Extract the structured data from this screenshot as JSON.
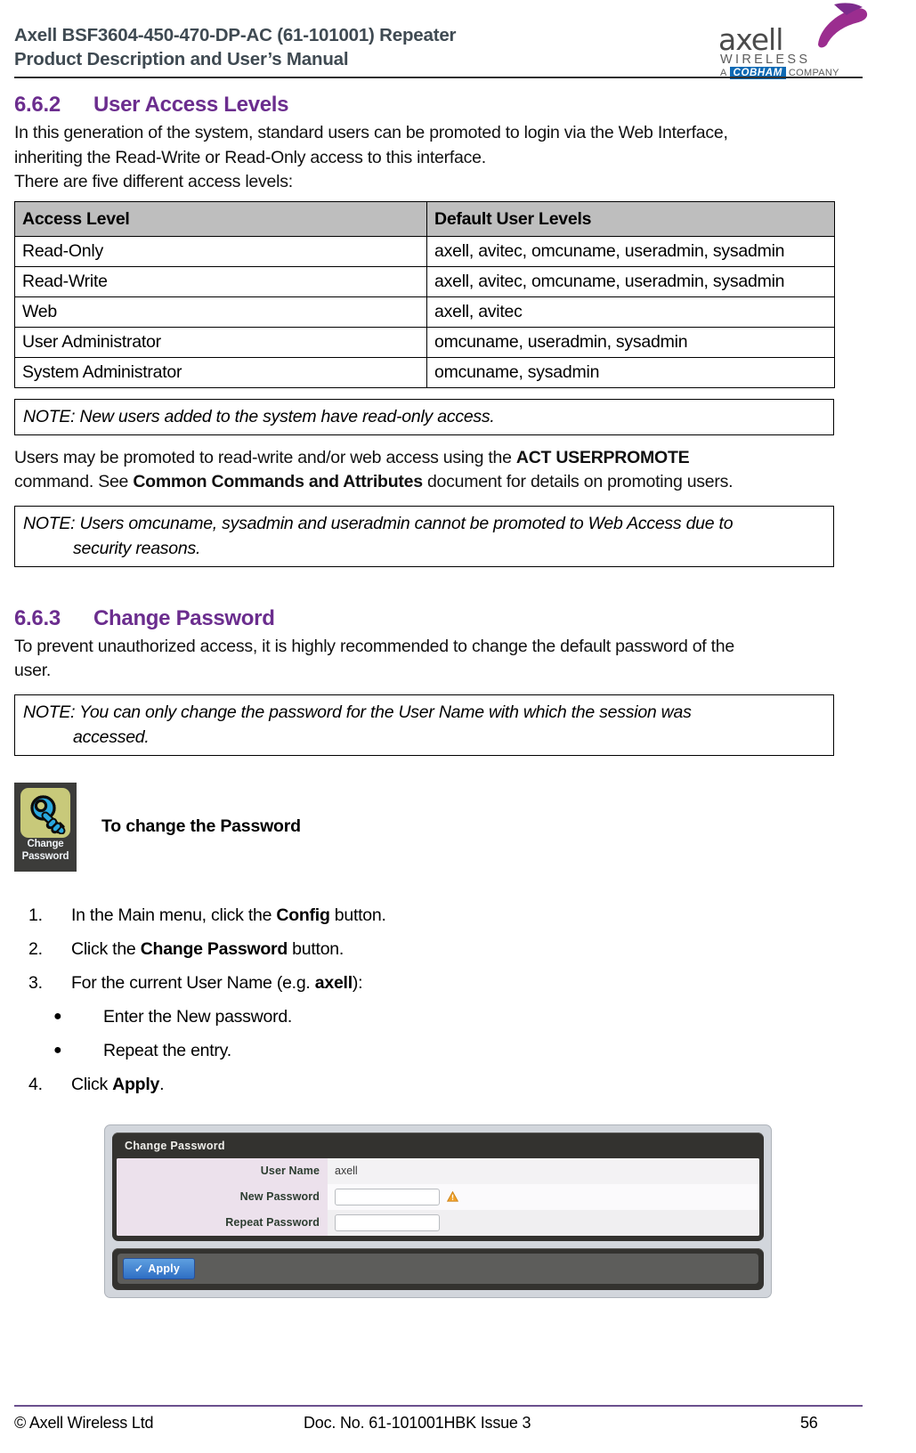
{
  "header": {
    "title_line1": "Axell BSF3604-450-470-DP-AC (61-101001) Repeater",
    "title_line2": "Product Description and User’s Manual",
    "logo": {
      "word": "axell",
      "wireless": "WIRELESS",
      "a": "A",
      "cobham": "COBHAM",
      "company": "COMPANY"
    }
  },
  "section_662": {
    "number": "6.6.2",
    "title": "User Access Levels",
    "intro_line1": "In this generation of the system, standard users can be promoted to login via the Web Interface,",
    "intro_line2": "inheriting the Read-Write or Read-Only access to this interface.",
    "intro_line3": "There are five different access levels:",
    "table": {
      "headers": [
        "Access Level",
        "Default User Levels"
      ],
      "rows": [
        [
          "Read-Only",
          "axell, avitec, omcuname, useradmin, sysadmin"
        ],
        [
          "Read-Write",
          "axell, avitec, omcuname, useradmin, sysadmin"
        ],
        [
          "Web",
          "axell, avitec"
        ],
        [
          "User Administrator",
          "omcuname, useradmin, sysadmin"
        ],
        [
          "System Administrator",
          "omcuname, sysadmin"
        ]
      ]
    },
    "note1": "NOTE: New users added to the system have read-only access.",
    "para_a": "Users may be promoted to read-write and/or web access using the ",
    "para_a_bold": "ACT USERPROMOTE",
    "para_b": "command. See ",
    "para_b_bold": "Common Commands and Attributes",
    "para_b_tail": " document for details on promoting users.",
    "note2_line1": "NOTE: Users omcuname, sysadmin and useradmin cannot be promoted to Web Access due to",
    "note2_line2": "security reasons."
  },
  "section_663": {
    "number": "6.6.3",
    "title": "Change Password",
    "intro_line1": "To prevent unauthorized access, it is highly recommended to change the default password of the",
    "intro_line2": "user.",
    "note_line1": "NOTE: You can only change the password for the User Name with which the session was",
    "note_line2": "accessed.",
    "callout": {
      "icon_caption_line1": "Change",
      "icon_caption_line2": "Password",
      "label": "To change the Password"
    },
    "steps": [
      {
        "marker": "1.",
        "pre": "In the Main menu, click the ",
        "bold": "Config",
        "post": " button."
      },
      {
        "marker": "2.",
        "pre": "Click the ",
        "bold": "Change Password",
        "post": " button."
      },
      {
        "marker": "3.",
        "pre": "For the current User Name (e.g. ",
        "bold": "axell",
        "post": "):"
      }
    ],
    "substeps": [
      {
        "bullet": "●",
        "text": "Enter the New password."
      },
      {
        "bullet": "●",
        "text": "Repeat the entry."
      }
    ],
    "step4": {
      "marker": "4.",
      "pre": "Click ",
      "bold": "Apply",
      "post": "."
    }
  },
  "ui_dialog": {
    "panel_title": "Change Password",
    "rows": [
      {
        "label": "User Name",
        "value": "axell",
        "type": "readonly"
      },
      {
        "label": "New Password",
        "value": "",
        "type": "input",
        "warning": true
      },
      {
        "label": "Repeat Password",
        "value": "",
        "type": "input",
        "warning": false
      }
    ],
    "apply_label": "Apply",
    "apply_check": "✓"
  },
  "footer": {
    "copyright": "© Axell Wireless Ltd",
    "doc": "Doc. No. 61-101001HBK Issue 3",
    "page": "56"
  },
  "colors": {
    "heading_purple": "#6b2d8e",
    "header_gray": "#3f4a52",
    "table_header_bg": "#bebebe",
    "cobham_blue": "#0f6ab4",
    "logo_magenta": "#9b2d8f",
    "icon_tile": "#c8c97a",
    "key_blue": "#29a8df",
    "footer_rule": "#6b4f8e"
  }
}
